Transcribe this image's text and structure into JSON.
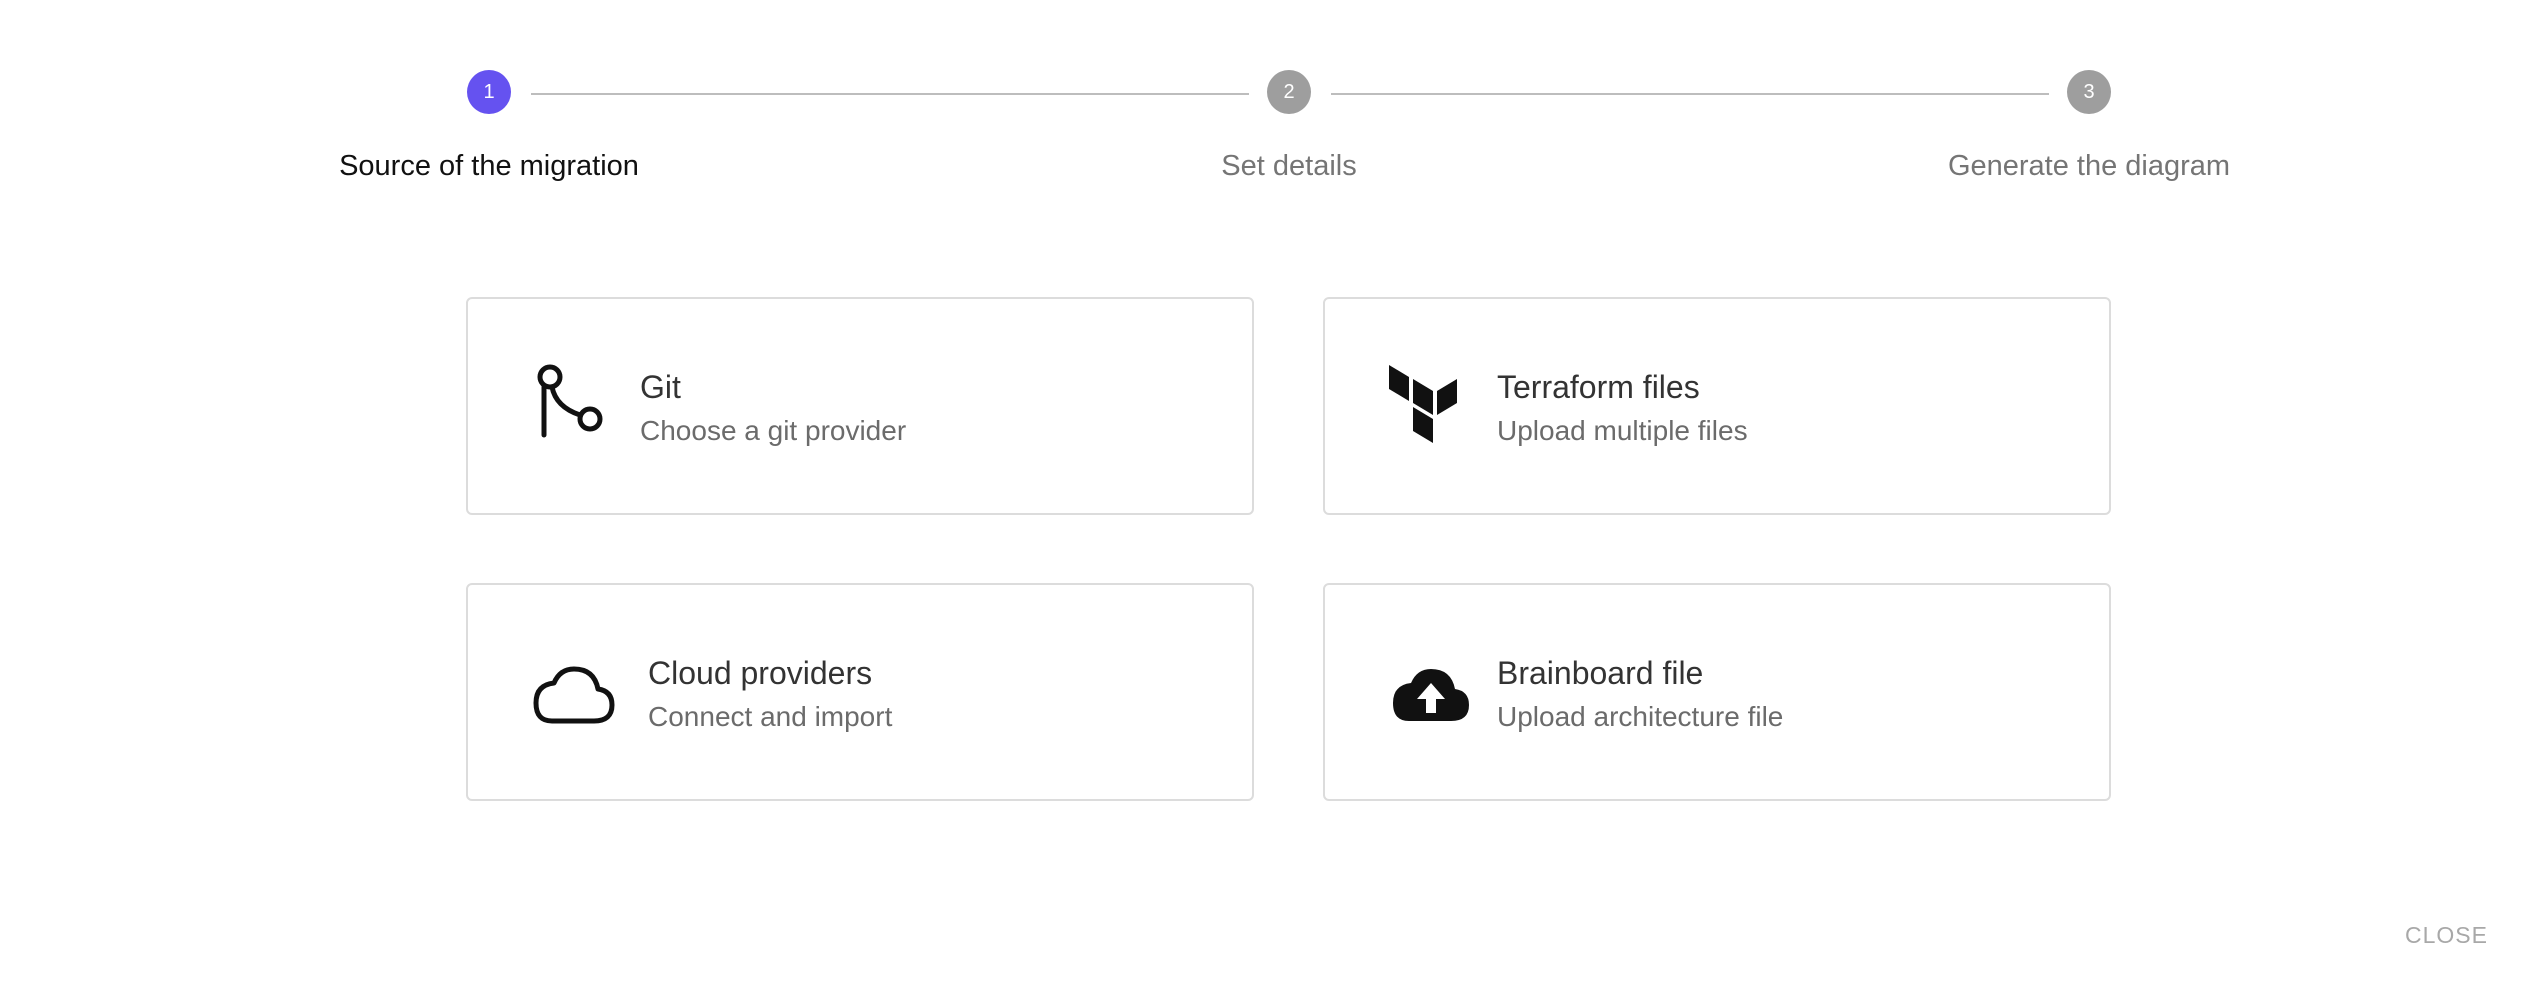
{
  "stepper": {
    "steps": [
      {
        "number": "1",
        "label": "Source of the migration",
        "state": "active"
      },
      {
        "number": "2",
        "label": "Set details",
        "state": "inactive"
      },
      {
        "number": "3",
        "label": "Generate the diagram",
        "state": "inactive"
      }
    ]
  },
  "options": [
    {
      "title": "Git",
      "subtitle": "Choose a git provider",
      "icon": "git-branch-icon"
    },
    {
      "title": "Terraform files",
      "subtitle": "Upload multiple files",
      "icon": "terraform-icon"
    },
    {
      "title": "Cloud providers",
      "subtitle": "Connect and import",
      "icon": "cloud-icon"
    },
    {
      "title": "Brainboard file",
      "subtitle": "Upload architecture file",
      "icon": "cloud-upload-icon"
    }
  ],
  "actions": {
    "close_label": "CLOSE"
  },
  "colors": {
    "accent": "#6552f0",
    "inactive": "#9e9e9e",
    "border": "#dcdcdc"
  }
}
